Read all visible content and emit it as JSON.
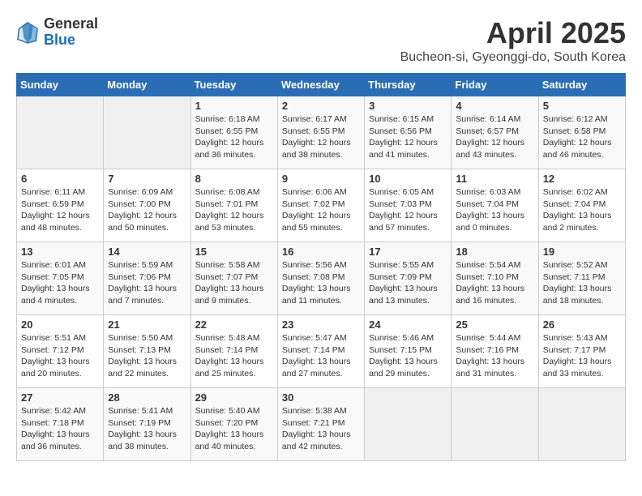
{
  "header": {
    "logo_general": "General",
    "logo_blue": "Blue",
    "title": "April 2025",
    "subtitle": "Bucheon-si, Gyeonggi-do, South Korea"
  },
  "days": [
    "Sunday",
    "Monday",
    "Tuesday",
    "Wednesday",
    "Thursday",
    "Friday",
    "Saturday"
  ],
  "weeks": [
    [
      {
        "num": "",
        "info": ""
      },
      {
        "num": "",
        "info": ""
      },
      {
        "num": "1",
        "info": "Sunrise: 6:18 AM\nSunset: 6:55 PM\nDaylight: 12 hours and 36 minutes."
      },
      {
        "num": "2",
        "info": "Sunrise: 6:17 AM\nSunset: 6:55 PM\nDaylight: 12 hours and 38 minutes."
      },
      {
        "num": "3",
        "info": "Sunrise: 6:15 AM\nSunset: 6:56 PM\nDaylight: 12 hours and 41 minutes."
      },
      {
        "num": "4",
        "info": "Sunrise: 6:14 AM\nSunset: 6:57 PM\nDaylight: 12 hours and 43 minutes."
      },
      {
        "num": "5",
        "info": "Sunrise: 6:12 AM\nSunset: 6:58 PM\nDaylight: 12 hours and 46 minutes."
      }
    ],
    [
      {
        "num": "6",
        "info": "Sunrise: 6:11 AM\nSunset: 6:59 PM\nDaylight: 12 hours and 48 minutes."
      },
      {
        "num": "7",
        "info": "Sunrise: 6:09 AM\nSunset: 7:00 PM\nDaylight: 12 hours and 50 minutes."
      },
      {
        "num": "8",
        "info": "Sunrise: 6:08 AM\nSunset: 7:01 PM\nDaylight: 12 hours and 53 minutes."
      },
      {
        "num": "9",
        "info": "Sunrise: 6:06 AM\nSunset: 7:02 PM\nDaylight: 12 hours and 55 minutes."
      },
      {
        "num": "10",
        "info": "Sunrise: 6:05 AM\nSunset: 7:03 PM\nDaylight: 12 hours and 57 minutes."
      },
      {
        "num": "11",
        "info": "Sunrise: 6:03 AM\nSunset: 7:04 PM\nDaylight: 13 hours and 0 minutes."
      },
      {
        "num": "12",
        "info": "Sunrise: 6:02 AM\nSunset: 7:04 PM\nDaylight: 13 hours and 2 minutes."
      }
    ],
    [
      {
        "num": "13",
        "info": "Sunrise: 6:01 AM\nSunset: 7:05 PM\nDaylight: 13 hours and 4 minutes."
      },
      {
        "num": "14",
        "info": "Sunrise: 5:59 AM\nSunset: 7:06 PM\nDaylight: 13 hours and 7 minutes."
      },
      {
        "num": "15",
        "info": "Sunrise: 5:58 AM\nSunset: 7:07 PM\nDaylight: 13 hours and 9 minutes."
      },
      {
        "num": "16",
        "info": "Sunrise: 5:56 AM\nSunset: 7:08 PM\nDaylight: 13 hours and 11 minutes."
      },
      {
        "num": "17",
        "info": "Sunrise: 5:55 AM\nSunset: 7:09 PM\nDaylight: 13 hours and 13 minutes."
      },
      {
        "num": "18",
        "info": "Sunrise: 5:54 AM\nSunset: 7:10 PM\nDaylight: 13 hours and 16 minutes."
      },
      {
        "num": "19",
        "info": "Sunrise: 5:52 AM\nSunset: 7:11 PM\nDaylight: 13 hours and 18 minutes."
      }
    ],
    [
      {
        "num": "20",
        "info": "Sunrise: 5:51 AM\nSunset: 7:12 PM\nDaylight: 13 hours and 20 minutes."
      },
      {
        "num": "21",
        "info": "Sunrise: 5:50 AM\nSunset: 7:13 PM\nDaylight: 13 hours and 22 minutes."
      },
      {
        "num": "22",
        "info": "Sunrise: 5:48 AM\nSunset: 7:14 PM\nDaylight: 13 hours and 25 minutes."
      },
      {
        "num": "23",
        "info": "Sunrise: 5:47 AM\nSunset: 7:14 PM\nDaylight: 13 hours and 27 minutes."
      },
      {
        "num": "24",
        "info": "Sunrise: 5:46 AM\nSunset: 7:15 PM\nDaylight: 13 hours and 29 minutes."
      },
      {
        "num": "25",
        "info": "Sunrise: 5:44 AM\nSunset: 7:16 PM\nDaylight: 13 hours and 31 minutes."
      },
      {
        "num": "26",
        "info": "Sunrise: 5:43 AM\nSunset: 7:17 PM\nDaylight: 13 hours and 33 minutes."
      }
    ],
    [
      {
        "num": "27",
        "info": "Sunrise: 5:42 AM\nSunset: 7:18 PM\nDaylight: 13 hours and 36 minutes."
      },
      {
        "num": "28",
        "info": "Sunrise: 5:41 AM\nSunset: 7:19 PM\nDaylight: 13 hours and 38 minutes."
      },
      {
        "num": "29",
        "info": "Sunrise: 5:40 AM\nSunset: 7:20 PM\nDaylight: 13 hours and 40 minutes."
      },
      {
        "num": "30",
        "info": "Sunrise: 5:38 AM\nSunset: 7:21 PM\nDaylight: 13 hours and 42 minutes."
      },
      {
        "num": "",
        "info": ""
      },
      {
        "num": "",
        "info": ""
      },
      {
        "num": "",
        "info": ""
      }
    ]
  ]
}
